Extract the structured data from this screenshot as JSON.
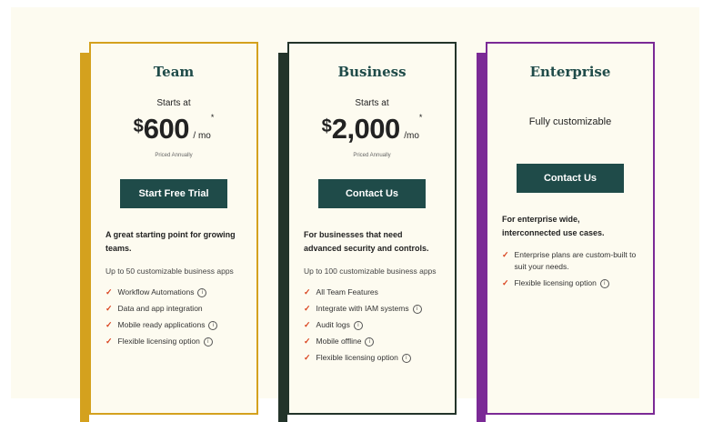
{
  "plans": [
    {
      "name": "Team",
      "starts_at": "Starts at",
      "currency": "$",
      "price": "600",
      "period": "/ mo",
      "asterisk": "*",
      "priced_note": "Priced Annually",
      "cta": "Start Free Trial",
      "tagline": "A great starting point for growing teams.",
      "apps": "Up to 50 customizable business apps",
      "features": [
        {
          "label": "Workflow Automations",
          "info": true
        },
        {
          "label": "Data and app integration",
          "info": false
        },
        {
          "label": "Mobile ready applications",
          "info": true
        },
        {
          "label": "Flexible licensing option",
          "info": true
        }
      ]
    },
    {
      "name": "Business",
      "starts_at": "Starts at",
      "currency": "$",
      "price": "2,000",
      "period": "/mo",
      "asterisk": "*",
      "priced_note": "Priced Annually",
      "cta": "Contact Us",
      "tagline": "For businesses that need advanced security and controls.",
      "apps": "Up to 100 customizable business apps",
      "features": [
        {
          "label": "All Team Features",
          "info": false
        },
        {
          "label": "Integrate with IAM systems",
          "info": true
        },
        {
          "label": "Audit logs",
          "info": true
        },
        {
          "label": "Mobile offline",
          "info": true
        },
        {
          "label": "Flexible licensing option",
          "info": true
        }
      ]
    },
    {
      "name": "Enterprise",
      "custom_text": "Fully customizable",
      "cta": "Contact Us",
      "tagline": "For enterprise wide, interconnected use cases.",
      "features": [
        {
          "label": "Enterprise plans are custom-built to suit your needs.",
          "info": false
        },
        {
          "label": "Flexible licensing option",
          "info": true
        }
      ]
    }
  ],
  "icons": {
    "check": "✓",
    "info": "i"
  },
  "colors": {
    "team_accent": "#d4a11e",
    "business_accent": "#23342a",
    "enterprise_accent": "#7b2a96",
    "button": "#1f4b49",
    "check": "#d9421d"
  }
}
